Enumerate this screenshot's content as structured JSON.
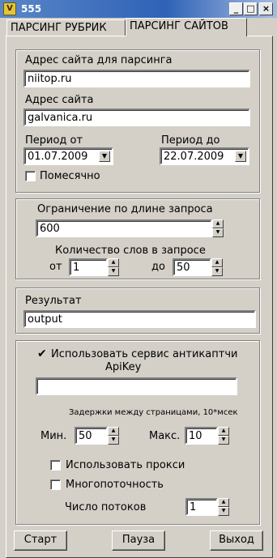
{
  "window": {
    "title": "555",
    "icon_letter": "V",
    "controls": {
      "minimize": "_",
      "maximize": "□",
      "close": "×"
    }
  },
  "tabs": [
    {
      "label": "ПАРСИНГ РУБРИК",
      "active": false
    },
    {
      "label": "ПАРСИНГ САЙТОВ",
      "active": true
    }
  ],
  "group1": {
    "site_parse_label": "Адрес сайта для парсинга",
    "site_parse_value": "niitop.ru",
    "site_label": "Адрес сайта",
    "site_value": "galvanica.ru",
    "period_from_label": "Период от",
    "period_from_value": "01.07.2009",
    "period_to_label": "Период до",
    "period_to_value": "22.07.2009",
    "monthly_label": "Помесячно",
    "monthly_checked": false
  },
  "group2": {
    "limit_label": "Ограничение по длине запроса",
    "limit_value": "600",
    "words_label": "Количество слов в запросе",
    "from_label": "от",
    "from_value": "1",
    "to_label": "до",
    "to_value": "50"
  },
  "group3": {
    "result_label": "Результат",
    "result_value": "output"
  },
  "group4": {
    "anticaptcha_label": "Использовать сервис антикаптчи",
    "anticaptcha_checked": true,
    "apikey_label": "ApiKey",
    "apikey_value": "",
    "delays_label": "Задержки между страницами, 10*мсек",
    "min_label": "Мин.",
    "min_value": "50",
    "max_label": "Макс.",
    "max_value": "10",
    "proxy_label": "Использовать прокси",
    "proxy_checked": false,
    "multithread_label": "Многопоточность",
    "multithread_checked": false,
    "threads_label": "Число потоков",
    "threads_value": "1"
  },
  "buttons": {
    "start": "Старт",
    "pause": "Пауза",
    "exit": "Выход"
  },
  "glyphs": {
    "dropdown": "▼",
    "spin_up": "▲",
    "spin_down": "▼",
    "check": "✔"
  }
}
